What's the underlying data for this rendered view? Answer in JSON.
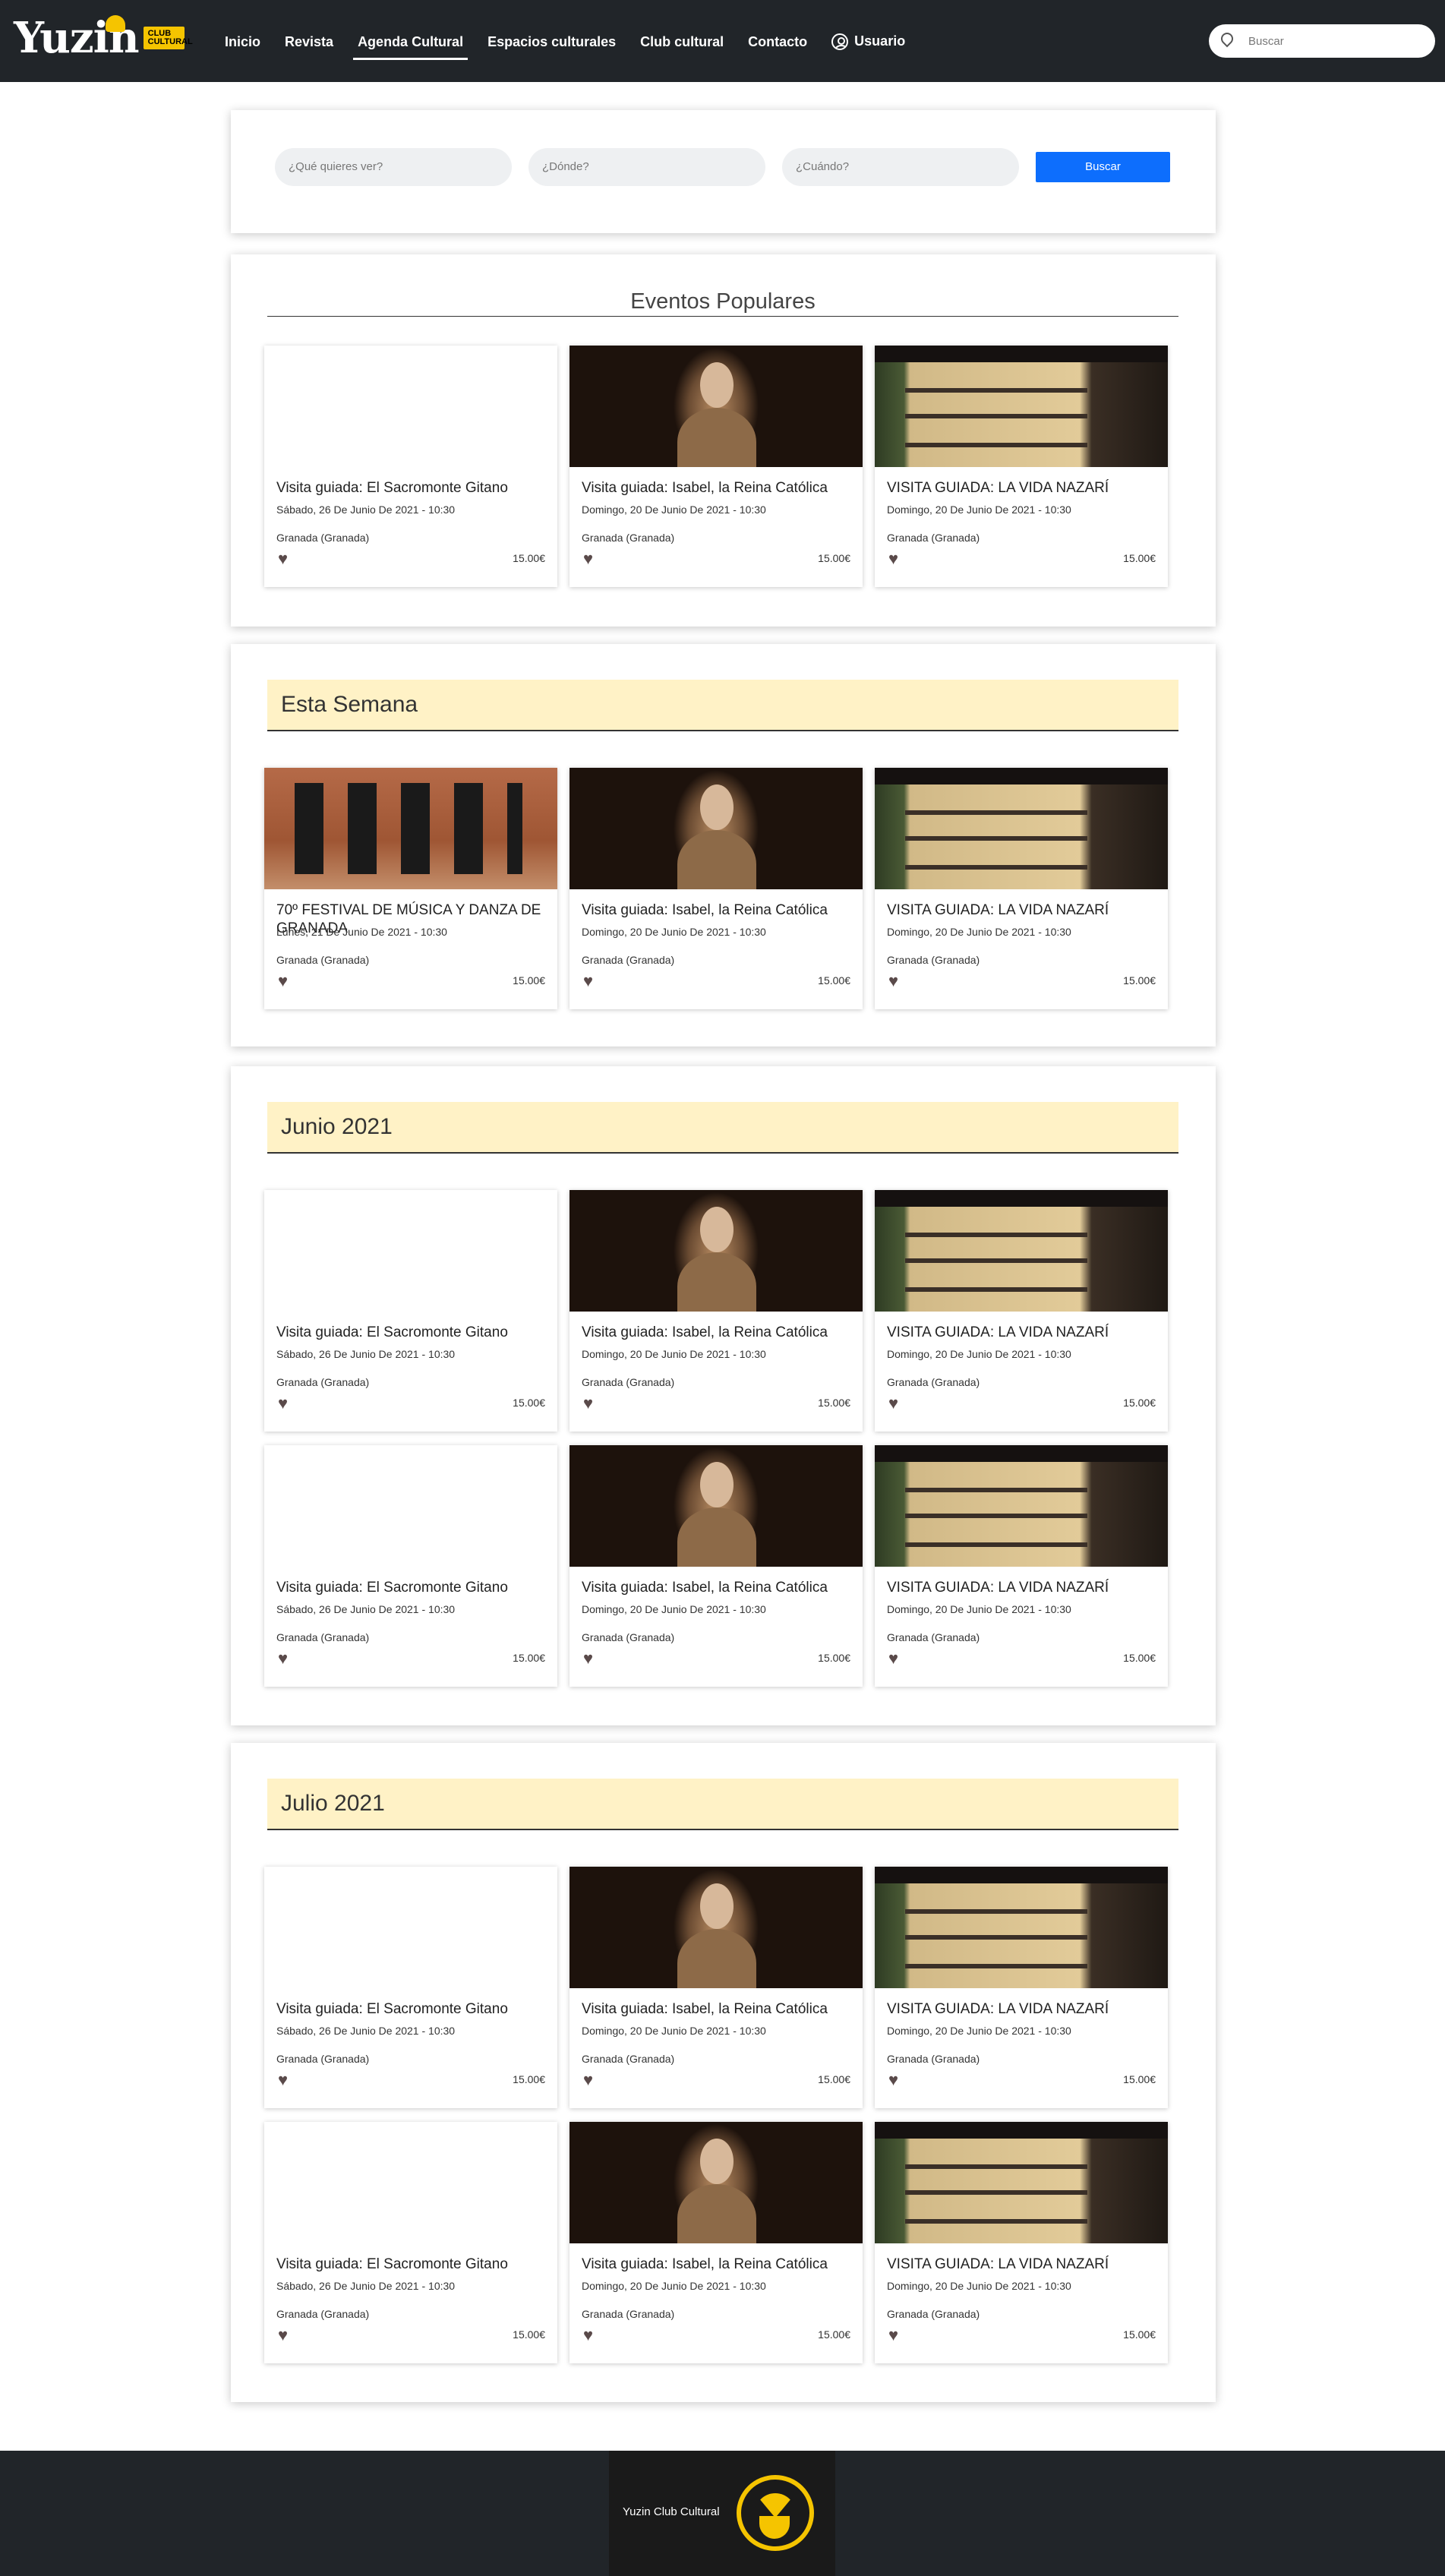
{
  "nav": {
    "logo_text": "Yuzin",
    "logo_badge": "CLUB CULTURAL",
    "links": [
      "Inicio",
      "Revista",
      "Agenda Cultural",
      "Espacios culturales",
      "Club cultural",
      "Contacto"
    ],
    "user_label": "Usuario",
    "search_placeholder": "Buscar"
  },
  "filter": {
    "what_placeholder": "¿Qué quieres ver?",
    "where_placeholder": "¿Dónde?",
    "when_placeholder": "¿Cuándo?",
    "button_label": "Buscar"
  },
  "sections": [
    {
      "title": "Eventos Populares",
      "events": [
        {
          "image": "sacromonte",
          "title": "Visita guiada: El Sacromonte Gitano",
          "date": "Sábado, 26 De Junio De 2021 - 10:30",
          "location": "Granada (Granada)",
          "price": "15.00€"
        },
        {
          "image": "isabel",
          "title": "Visita guiada: Isabel, la Reina Católica",
          "date": "Domingo, 20 De Junio De 2021 - 10:30",
          "location": "Granada (Granada)",
          "price": "15.00€"
        },
        {
          "image": "nazari",
          "title": "VISITA GUIADA: LA VIDA NAZARÍ",
          "date": "Domingo, 20 De Junio De 2021 - 10:30",
          "location": "Granada (Granada)",
          "price": "15.00€"
        }
      ]
    },
    {
      "title": "Esta Semana",
      "events": [
        {
          "image": "trombon",
          "title": "70º FESTIVAL DE MÚSICA Y DANZA DE GRANADA",
          "date": "Lunes, 21 De Junio De 2021 - 10:30",
          "location": "Granada (Granada)",
          "price": "15.00€"
        },
        {
          "image": "isabel",
          "title": "Visita guiada: Isabel, la Reina Católica",
          "date": "Domingo, 20 De Junio De 2021 - 10:30",
          "location": "Granada (Granada)",
          "price": "15.00€"
        },
        {
          "image": "nazari",
          "title": "VISITA GUIADA: LA VIDA NAZARÍ",
          "date": "Domingo, 20 De Junio De 2021 - 10:30",
          "location": "Granada (Granada)",
          "price": "15.00€"
        }
      ]
    },
    {
      "title": "Junio 2021",
      "events": [
        {
          "image": "sacromonte",
          "title": "Visita guiada: El Sacromonte Gitano",
          "date": "Sábado, 26 De Junio De 2021 - 10:30",
          "location": "Granada (Granada)",
          "price": "15.00€"
        },
        {
          "image": "isabel",
          "title": "Visita guiada: Isabel, la Reina Católica",
          "date": "Domingo, 20 De Junio De 2021 - 10:30",
          "location": "Granada (Granada)",
          "price": "15.00€"
        },
        {
          "image": "nazari",
          "title": "VISITA GUIADA: LA VIDA NAZARÍ",
          "date": "Domingo, 20 De Junio De 2021 - 10:30",
          "location": "Granada (Granada)",
          "price": "15.00€"
        },
        {
          "image": "sacromonte",
          "title": "Visita guiada: El Sacromonte Gitano",
          "date": "Sábado, 26 De Junio De 2021 - 10:30",
          "location": "Granada (Granada)",
          "price": "15.00€"
        },
        {
          "image": "isabel",
          "title": "Visita guiada: Isabel, la Reina Católica",
          "date": "Domingo, 20 De Junio De 2021 - 10:30",
          "location": "Granada (Granada)",
          "price": "15.00€"
        },
        {
          "image": "nazari",
          "title": "VISITA GUIADA: LA VIDA NAZARÍ",
          "date": "Domingo, 20 De Junio De 2021 - 10:30",
          "location": "Granada (Granada)",
          "price": "15.00€"
        }
      ]
    },
    {
      "title": "Julio 2021",
      "events": [
        {
          "image": "sacromonte",
          "title": "Visita guiada: El Sacromonte Gitano",
          "date": "Sábado, 26 De Junio De 2021 - 10:30",
          "location": "Granada (Granada)",
          "price": "15.00€"
        },
        {
          "image": "isabel",
          "title": "Visita guiada: Isabel, la Reina Católica",
          "date": "Domingo, 20 De Junio De 2021 - 10:30",
          "location": "Granada (Granada)",
          "price": "15.00€"
        },
        {
          "image": "nazari",
          "title": "VISITA GUIADA: LA VIDA NAZARÍ",
          "date": "Domingo, 20 De Junio De 2021 - 10:30",
          "location": "Granada (Granada)",
          "price": "15.00€"
        },
        {
          "image": "sacromonte",
          "title": "Visita guiada: El Sacromonte Gitano",
          "date": "Sábado, 26 De Junio De 2021 - 10:30",
          "location": "Granada (Granada)",
          "price": "15.00€"
        },
        {
          "image": "isabel",
          "title": "Visita guiada: Isabel, la Reina Católica",
          "date": "Domingo, 20 De Junio De 2021 - 10:30",
          "location": "Granada (Granada)",
          "price": "15.00€"
        },
        {
          "image": "nazari",
          "title": "VISITA GUIADA: LA VIDA NAZARÍ",
          "date": "Domingo, 20 De Junio De 2021 - 10:30",
          "location": "Granada (Granada)",
          "price": "15.00€"
        }
      ]
    }
  ],
  "footer": {
    "text": "Yuzin Club Cultural"
  },
  "colors": {
    "nav_bg": "#212529",
    "accent_yellow": "#f5c400",
    "section_header_bg": "#fff2c6",
    "button_blue": "#0d6efd"
  },
  "icons": {
    "favorite": "heart-icon",
    "location": "map-pin-icon",
    "user": "user-circle-icon"
  }
}
